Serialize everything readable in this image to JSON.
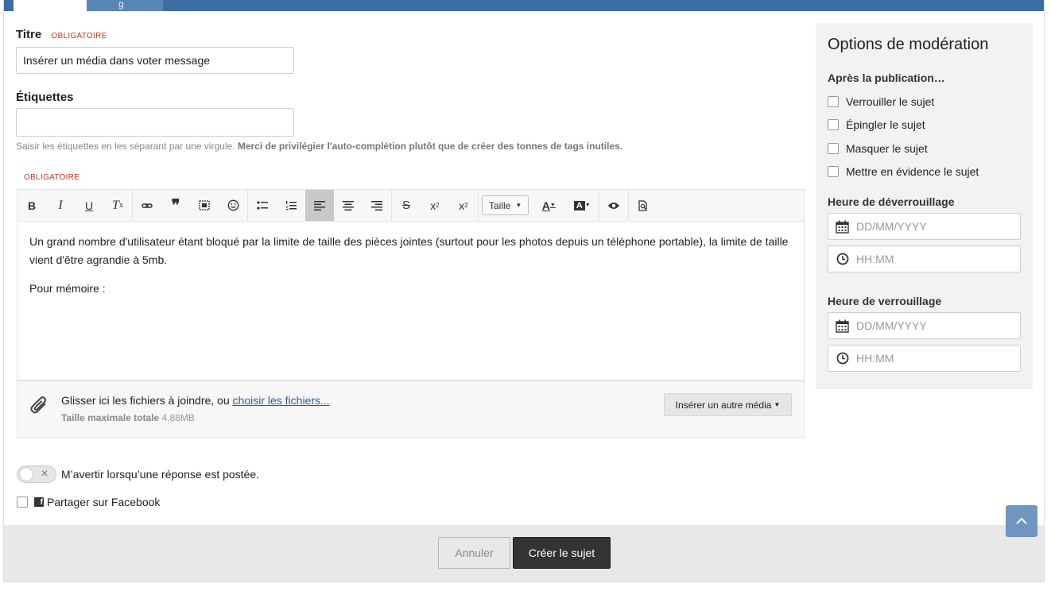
{
  "tabs": [
    {
      "label": ""
    },
    {
      "label": "g"
    }
  ],
  "form": {
    "title_label": "Titre",
    "required_text": "OBLIGATOIRE",
    "title_value": "Insérer un média dans voter message",
    "tags_label": "Étiquettes",
    "tags_value": "",
    "tags_help": "Saisir les étiquettes en les séparant par une virgule.",
    "tags_help_bold": "Merci de privilégier l'auto-complétion plutôt que de créer des tonnes de tags inutiles.",
    "editor_required": "OBLIGATOIRE"
  },
  "toolbar": {
    "size_label": "Taille"
  },
  "editor": {
    "paragraph1": "Un grand nombre d'utilisateur étant bloqué par la limite de taille des pièces jointes (surtout pour les photos depuis un téléphone portable), la limite de taille vient d'être agrandie à 5mb.",
    "paragraph2": "Pour mémoire :"
  },
  "attachments": {
    "drop_text": "Glisser ici les fichiers à joindre, ou",
    "choose_link": "choisir les fichiers...",
    "max_size_label": "Taille maximale totale",
    "max_size_value": "4,88MB",
    "insert_media_button": "Insérer un autre média"
  },
  "notify": {
    "label": "M’avertir lorsqu’une réponse est postée.",
    "enabled": false
  },
  "facebook": {
    "label": "Partager sur Facebook",
    "checked": false
  },
  "moderation": {
    "title": "Options de modération",
    "after_publish_label": "Après la publication…",
    "options": [
      {
        "label": "Verrouiller le sujet",
        "checked": false
      },
      {
        "label": "Épingler le sujet",
        "checked": false
      },
      {
        "label": "Masquer le sujet",
        "checked": false
      },
      {
        "label": "Mettre en évidence le sujet",
        "checked": false
      }
    ],
    "unlock_label": "Heure de déverrouillage",
    "lock_label": "Heure de verrouillage",
    "date_placeholder": "DD/MM/YYYY",
    "time_placeholder": "HH:MM"
  },
  "footer": {
    "cancel_label": "Annuler",
    "create_label": "Créer le sujet"
  },
  "colors": {
    "brand_blue": "#3b6ea5",
    "required_red": "#c0392b",
    "primary_button": "#333333"
  }
}
